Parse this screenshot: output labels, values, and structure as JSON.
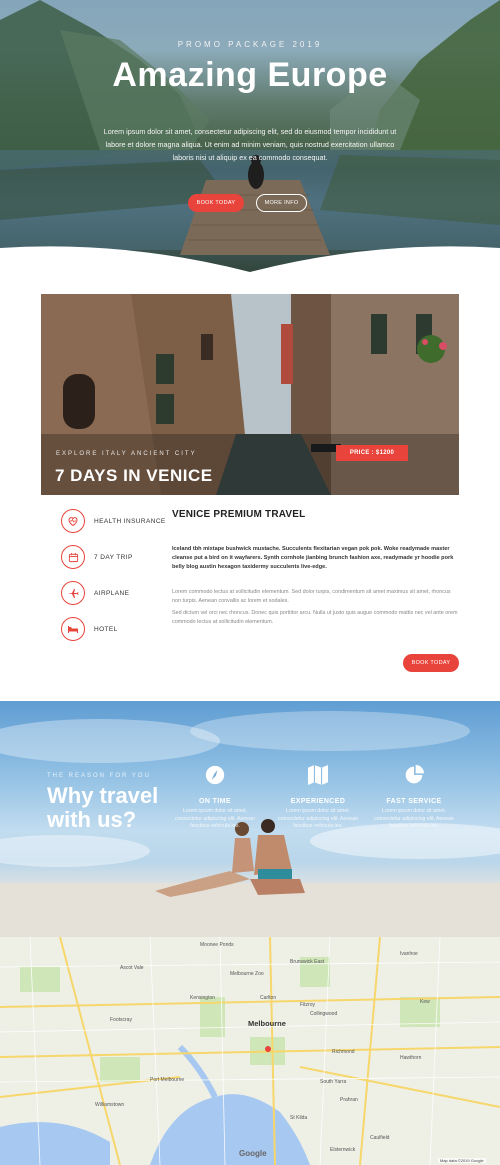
{
  "hero": {
    "kicker": "PROMO PACKAGE 2019",
    "title": "Amazing Europe",
    "text": "Lorem ipsum dolor sit amet, consectetur adipiscing elit, sed do eiusmod tempor incididunt ut labore et dolore magna aliqua. Ut enim ad minim veniam, quis nostrud exercitation ullamco laboris nisi ut aliquip ex ea commodo consequat.",
    "book_label": "BOOK TODAY",
    "more_label": "MORE INFO"
  },
  "venice": {
    "kicker": "EXPLORE ITALY ANCIENT CITY",
    "title": "7 DAYS IN VENICE",
    "price": "PRICE : $1200"
  },
  "features": [
    {
      "label": "HEALTH INSURANCE",
      "icon": "heart-icon"
    },
    {
      "label": "7 DAY TRIP",
      "icon": "calendar-icon"
    },
    {
      "label": "AIRPLANE",
      "icon": "airplane-icon"
    },
    {
      "label": "HOTEL",
      "icon": "bed-icon"
    }
  ],
  "detail": {
    "title": "VENICE PREMIUM TRAVEL",
    "bold_text": "Iceland tbh mixtape bushwick mustache. Succulents flexitarian vegan pok pok. Woke readymade master cleanse put a bird on it wayfarers. Synth cornhole jianbing brunch fashion axe, readymade yr hoodie pork belly blog austin hexagon taxidermy succulents live-edge.",
    "para1": "Lorem commodo lectus at sollicitudin elementum. Sed dolor turpis, condimentum sit amet maximus sit amet, rhoncus non turpis. Aenean convallis ac lorem et sodales.",
    "para2": "Sed dictum vel orci nec rhoncus. Donec quis porttitor arcu. Nulla ut justo quis augue commodo mattis nec vel ante orem commodo lectus at sollicitudin elementum.",
    "book_label": "BOOK TODAY"
  },
  "why": {
    "kicker": "THE REASON FOR YOU",
    "title_line1": "Why travel",
    "title_line2": "with us?",
    "columns": [
      {
        "title": "ON TIME",
        "text": "Lorem ipsum dolor sit amet, consectetur adipiscing elit. Aenean faucibus vehicula leo.",
        "icon": "compass-icon"
      },
      {
        "title": "EXPERIENCED",
        "text": "Lorem ipsum dolor sit amet, consectetur adipiscing elit. Aenean faucibus vehicula leo.",
        "icon": "map-icon"
      },
      {
        "title": "FAST SERVICE",
        "text": "Lorem ipsum dolor sit amet, consectetur adipiscing elit. Aenean faucibus vehicula leo.",
        "icon": "pie-chart-icon"
      }
    ]
  },
  "map": {
    "city": "Melbourne",
    "labels": [
      "Moonee Ponds",
      "Brunswick East",
      "Ivanhoe",
      "Ascot Vale",
      "Melbourne Zoo",
      "Kensington",
      "Carlton",
      "Fitzroy",
      "Collingwood",
      "Kew",
      "Footscray",
      "Richmond",
      "South Yarra",
      "Prahran",
      "St Kilda",
      "Williamstown",
      "Port Melbourne",
      "Hawthorn",
      "Caulfield",
      "Elsternwick"
    ],
    "google": "Google",
    "attribution": "Map data ©2019 Google"
  },
  "colors": {
    "accent": "#e8443b"
  }
}
